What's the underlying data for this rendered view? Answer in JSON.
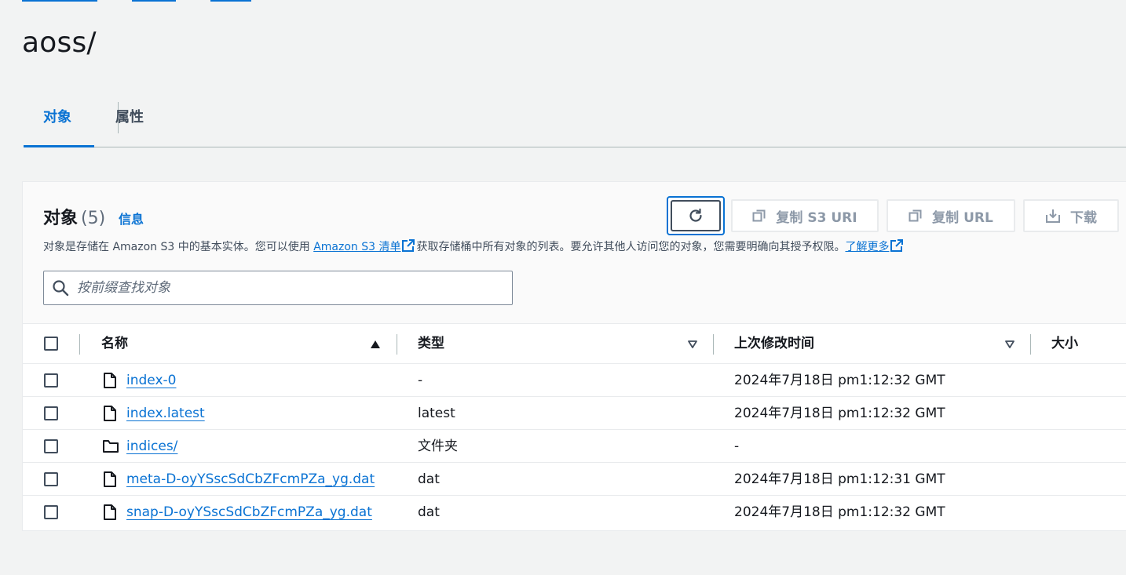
{
  "page": {
    "title": "aoss/"
  },
  "tabs": [
    {
      "label": "对象",
      "active": true
    },
    {
      "label": "属性",
      "active": false
    }
  ],
  "objects": {
    "title": "对象",
    "count": "(5)",
    "info_link": "信息",
    "description_pre": "对象是存储在 Amazon S3 中的基本实体。您可以使用 ",
    "inventory_link": "Amazon S3 清单",
    "description_mid": "获取存储桶中所有对象的列表。要允许其他人访问您的对象，您需要明确向其授予权限。",
    "learn_more_link": "了解更多",
    "buttons": {
      "copy_s3_uri": "复制 S3 URI",
      "copy_url": "复制 URL",
      "download": "下载"
    },
    "search": {
      "placeholder": "按前缀查找对象",
      "value": ""
    },
    "columns": {
      "name": "名称",
      "type": "类型",
      "last_modified": "上次修改时间",
      "size": "大小"
    },
    "rows": [
      {
        "name": "index-0",
        "type": "-",
        "last_modified": "2024年7月18日 pm1:12:32 GMT",
        "icon": "file-icon"
      },
      {
        "name": "index.latest",
        "type": "latest",
        "last_modified": "2024年7月18日 pm1:12:32 GMT",
        "icon": "file-icon"
      },
      {
        "name": "indices/",
        "type": "文件夹",
        "last_modified": "-",
        "icon": "folder-icon"
      },
      {
        "name": "meta-D-oyYSscSdCbZFcmPZa_yg.dat",
        "type": "dat",
        "last_modified": "2024年7月18日 pm1:12:31 GMT",
        "icon": "file-icon"
      },
      {
        "name": "snap-D-oyYSscSdCbZFcmPZa_yg.dat",
        "type": "dat",
        "last_modified": "2024年7月18日 pm1:12:32 GMT",
        "icon": "file-icon"
      }
    ]
  },
  "colors": {
    "accent": "#0972d3",
    "text": "#16191f",
    "disabled": "#8d99a8",
    "border": "#e9ebed"
  }
}
